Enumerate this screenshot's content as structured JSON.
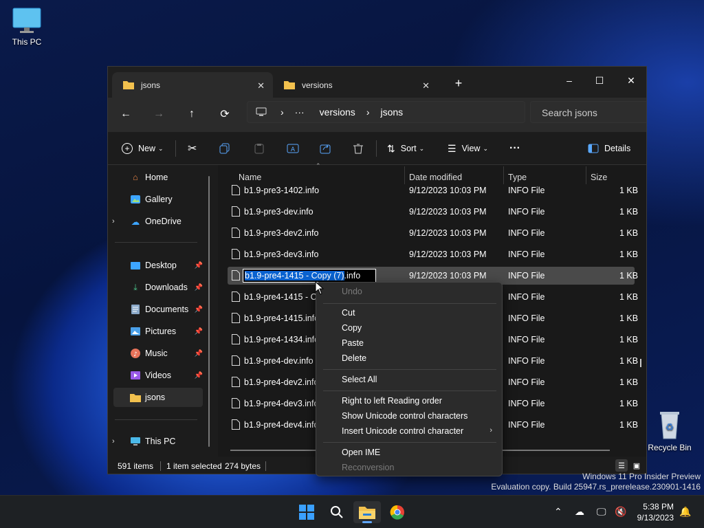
{
  "desktop": {
    "this_pc_label": "This PC",
    "recycle_bin_label": "Recycle Bin",
    "watermark_line1": "Windows 11 Pro Insider Preview",
    "watermark_line2": "Evaluation copy. Build 25947.rs_prerelease.230901-1416"
  },
  "window": {
    "tabs": [
      {
        "label": "jsons",
        "active": true
      },
      {
        "label": "versions",
        "active": false
      }
    ],
    "new_tab_label": "+",
    "controls": {
      "minimize": "–",
      "maximize": "☐",
      "close": "✕"
    },
    "address": {
      "ellipsis": "···",
      "crumb1": "versions",
      "crumb2": "jsons",
      "sep": "›"
    },
    "search_placeholder": "Search jsons",
    "toolbar": {
      "new_label": "New",
      "sort_label": "Sort",
      "view_label": "View",
      "more_label": "···",
      "details_label": "Details"
    },
    "nav": {
      "home": "Home",
      "gallery": "Gallery",
      "onedrive": "OneDrive",
      "desktop": "Desktop",
      "downloads": "Downloads",
      "documents": "Documents",
      "pictures": "Pictures",
      "music": "Music",
      "videos": "Videos",
      "jsons": "jsons",
      "thispc": "This PC"
    },
    "columns": {
      "name": "Name",
      "date": "Date modified",
      "type": "Type",
      "size": "Size"
    },
    "files": [
      {
        "name": "b1.9-pre3-1402.info",
        "date": "9/12/2023 10:03 PM",
        "type": "INFO File",
        "size": "1 KB"
      },
      {
        "name": "b1.9-pre3-dev.info",
        "date": "9/12/2023 10:03 PM",
        "type": "INFO File",
        "size": "1 KB"
      },
      {
        "name": "b1.9-pre3-dev2.info",
        "date": "9/12/2023 10:03 PM",
        "type": "INFO File",
        "size": "1 KB"
      },
      {
        "name": "b1.9-pre3-dev3.info",
        "date": "9/12/2023 10:03 PM",
        "type": "INFO File",
        "size": "1 KB"
      },
      {
        "name": "b1.9-pre4-1415 - Copy (7).info",
        "date": "9/12/2023 10:03 PM",
        "type": "INFO File",
        "size": "1 KB"
      },
      {
        "name": "b1.9-pre4-1415 - Co",
        "date": "",
        "type": "INFO File",
        "size": "1 KB"
      },
      {
        "name": "b1.9-pre4-1415.info",
        "date": "",
        "type": "INFO File",
        "size": "1 KB"
      },
      {
        "name": "b1.9-pre4-1434.info",
        "date": "",
        "type": "INFO File",
        "size": "1 KB"
      },
      {
        "name": "b1.9-pre4-dev.info",
        "date": "",
        "type": "INFO File",
        "size": "1 KB"
      },
      {
        "name": "b1.9-pre4-dev2.info",
        "date": "",
        "type": "INFO File",
        "size": "1 KB"
      },
      {
        "name": "b1.9-pre4-dev3.info",
        "date": "",
        "type": "INFO File",
        "size": "1 KB"
      },
      {
        "name": "b1.9-pre4-dev4.info",
        "date": "",
        "type": "INFO File",
        "size": "1 KB"
      }
    ],
    "rename": {
      "selected_part": "b1.9-pre4-1415 - Copy (7)",
      "extension": ".info"
    },
    "status": {
      "items": "591 items",
      "selected": "1 item selected",
      "bytes": "274 bytes"
    }
  },
  "context_menu": {
    "undo": "Undo",
    "cut": "Cut",
    "copy": "Copy",
    "paste": "Paste",
    "delete": "Delete",
    "select_all": "Select All",
    "rtl": "Right to left Reading order",
    "show_unicode": "Show Unicode control characters",
    "insert_unicode": "Insert Unicode control character",
    "open_ime": "Open IME",
    "reconversion": "Reconversion"
  },
  "taskbar": {
    "time": "5:38 PM",
    "date": "9/13/2023"
  },
  "colors": {
    "accent": "#0a62d0",
    "folder": "#f2c14e"
  }
}
